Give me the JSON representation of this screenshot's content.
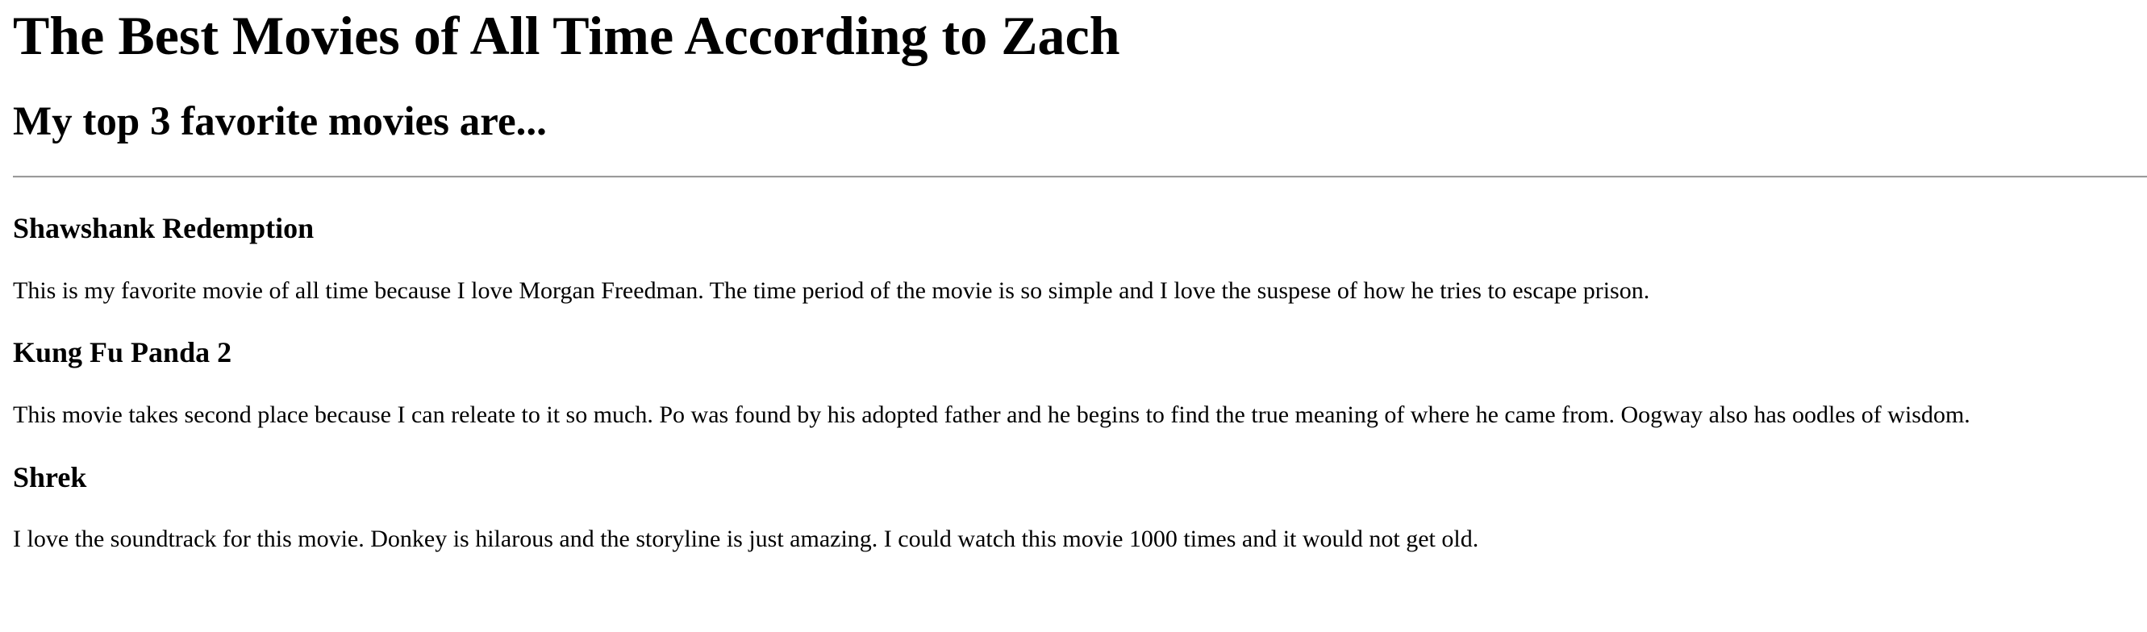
{
  "page": {
    "title": "The Best Movies of All Time According to Zach",
    "subtitle": "My top 3 favorite movies are..."
  },
  "movies": [
    {
      "title": "Shawshank Redemption",
      "description": "This is my favorite movie of all time because I love Morgan Freedman. The time period of the movie is so simple and I love the suspese of how he tries to escape prison."
    },
    {
      "title": "Kung Fu Panda 2",
      "description": "This movie takes second place because I can releate to it so much. Po was found by his adopted father and he begins to find the true meaning of where he came from. Oogway also has oodles of wisdom."
    },
    {
      "title": "Shrek",
      "description": "I love the soundtrack for this movie. Donkey is hilarous and the storyline is just amazing. I could watch this movie 1000 times and it would not get old."
    }
  ]
}
